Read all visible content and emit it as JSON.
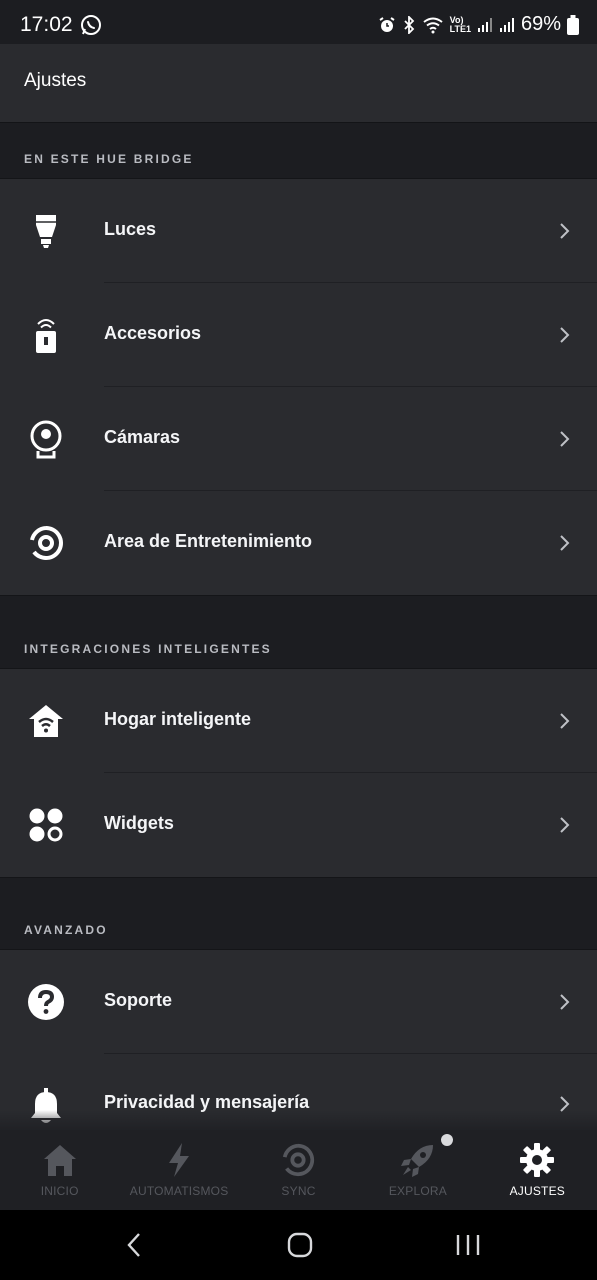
{
  "status_bar": {
    "time": "17:02",
    "battery": "69%",
    "network_label_top": "Vo)",
    "network_label_bottom": "LTE1"
  },
  "header": {
    "title": "Ajustes"
  },
  "sections": [
    {
      "label": "EN ESTE HUE BRIDGE",
      "items": [
        {
          "label": "Luces",
          "icon": "bulb-icon"
        },
        {
          "label": "Accesorios",
          "icon": "remote-icon"
        },
        {
          "label": "Cámaras",
          "icon": "camera-icon"
        },
        {
          "label": "Area de Entretenimiento",
          "icon": "entertainment-icon"
        }
      ]
    },
    {
      "label": "INTEGRACIONES INTELIGENTES",
      "items": [
        {
          "label": "Hogar inteligente",
          "icon": "smart-home-icon"
        },
        {
          "label": "Widgets",
          "icon": "widgets-icon"
        }
      ]
    },
    {
      "label": "AVANZADO",
      "items": [
        {
          "label": "Soporte",
          "icon": "help-icon"
        },
        {
          "label": "Privacidad y mensajería",
          "icon": "bell-icon"
        }
      ]
    }
  ],
  "tab_bar": {
    "tabs": [
      {
        "label": "INICIO",
        "icon": "home-icon",
        "active": false
      },
      {
        "label": "AUTOMATISMOS",
        "icon": "lightning-icon",
        "active": false
      },
      {
        "label": "SYNC",
        "icon": "sync-icon",
        "active": false
      },
      {
        "label": "EXPLORA",
        "icon": "rocket-icon",
        "active": false
      },
      {
        "label": "AJUSTES",
        "icon": "gear-icon",
        "active": true
      }
    ]
  },
  "colors": {
    "background": "#1c1d21",
    "card": "#2a2b2f",
    "section_label": "#b9bbc1",
    "tab_inactive": "#55575d",
    "tab_active": "#ffffff"
  }
}
